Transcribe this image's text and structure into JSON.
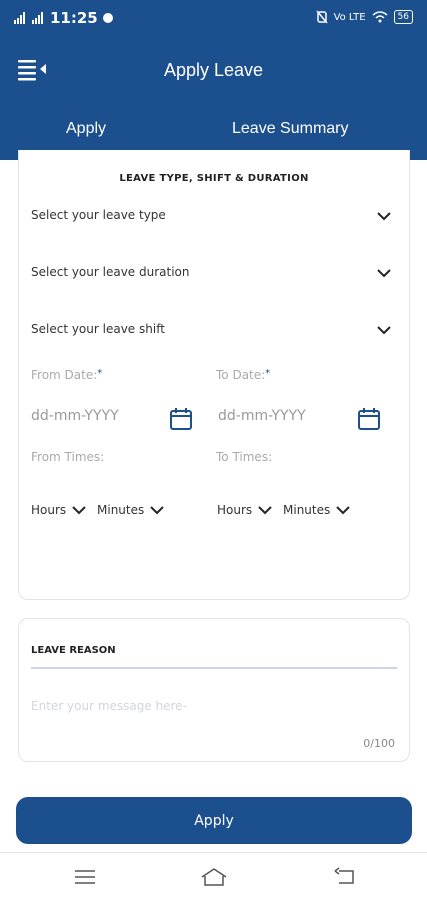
{
  "status_bar": {
    "time": "11:25",
    "network": "Vo LTE",
    "battery": "56"
  },
  "header": {
    "title": "Apply Leave",
    "tabs": [
      {
        "label": "Apply",
        "active": true
      },
      {
        "label": "Leave Summary",
        "active": false
      }
    ]
  },
  "leave_form": {
    "section_title": "LEAVE TYPE, SHIFT & DURATION",
    "selects": [
      {
        "label": "Select your leave type"
      },
      {
        "label": "Select your leave duration"
      },
      {
        "label": "Select your leave shift"
      }
    ],
    "from_date_label": "From Date:",
    "to_date_label": "To Date:",
    "required_mark": "*",
    "from_date_placeholder": "dd-mm-YYYY",
    "to_date_placeholder": "dd-mm-YYYY",
    "from_times_label": "From Times:",
    "to_times_label": "To Times:",
    "hours_label": "Hours",
    "minutes_label": "Minutes"
  },
  "reason": {
    "title": "LEAVE REASON",
    "placeholder": "Enter your message here-",
    "counter": "0/100"
  },
  "apply_button": "Apply",
  "colors": {
    "primary": "#1b4f8e",
    "border": "#e0e4ea"
  },
  "icons": {
    "menu": "menu-collapse-icon",
    "chevron": "chevron-down-icon",
    "calendar": "calendar-icon",
    "nav": [
      "recents-icon",
      "home-icon",
      "back-icon"
    ]
  }
}
